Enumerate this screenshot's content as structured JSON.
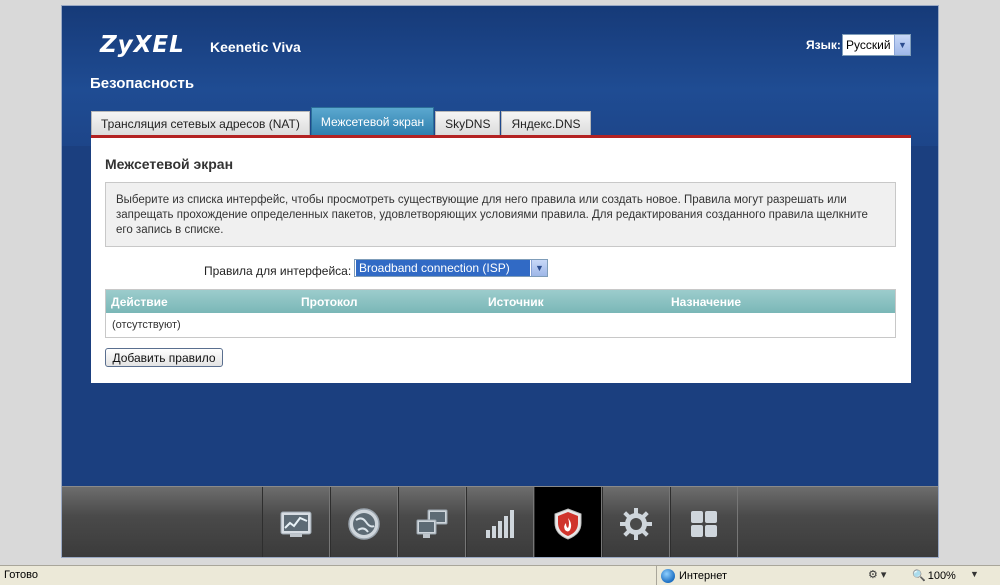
{
  "header": {
    "brand": "ZyXEL",
    "model": "Keenetic Viva",
    "language_label": "Язык:",
    "language_value": "Русский",
    "section_title": "Безопасность"
  },
  "tabs": [
    {
      "label": "Трансляция сетевых адресов (NAT)",
      "active": false
    },
    {
      "label": "Межсетевой экран",
      "active": true
    },
    {
      "label": "SkyDNS",
      "active": false
    },
    {
      "label": "Яндекс.DNS",
      "active": false
    }
  ],
  "panel": {
    "title": "Межсетевой экран",
    "info_text": "Выберите из списка интерфейс, чтобы просмотреть существующие для него правила или создать новое. Правила могут разрешать или запрещать прохождение определенных пакетов, удовлетворяющих условиями правила. Для редактирования созданного правила щелкните его запись в списке.",
    "interface_label": "Правила для интерфейса:",
    "interface_value": "Broadband connection (ISP)",
    "table": {
      "columns": [
        "Действие",
        "Протокол",
        "Источник",
        "Назначение"
      ],
      "empty_text": "(отсутствуют)"
    },
    "add_button": "Добавить правило"
  },
  "navbar": {
    "items": [
      {
        "icon": "monitor-chart-icon"
      },
      {
        "icon": "globe-icon"
      },
      {
        "icon": "network-computers-icon"
      },
      {
        "icon": "signal-bars-icon"
      },
      {
        "icon": "shield-icon",
        "active": true
      },
      {
        "icon": "gear-icon"
      },
      {
        "icon": "apps-grid-icon"
      }
    ]
  },
  "statusbar": {
    "status_text": "Готово",
    "zone_text": "Интернет",
    "zoom": "100%"
  },
  "colors": {
    "frame_bg": "#1b3f7f",
    "tab_active": "#2f7fae",
    "tab_line": "#b32222",
    "table_header": "#7ab7b7",
    "navbar_active": "#000000"
  }
}
